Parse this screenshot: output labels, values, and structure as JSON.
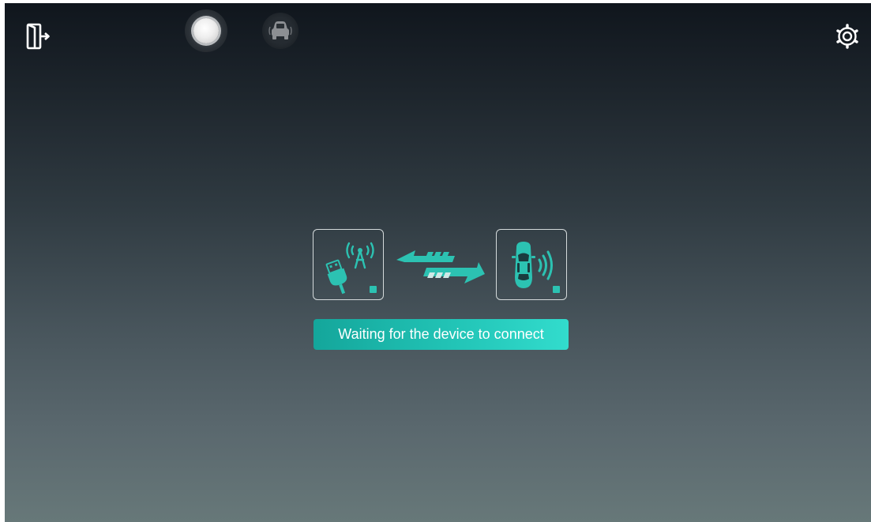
{
  "header": {
    "exit_icon": "exit-door-icon",
    "record_icon": "record-circle-icon",
    "mode_icon": "car-rear-icon",
    "settings_icon": "gear-icon"
  },
  "connection": {
    "device_icon": "usb-antenna-icon",
    "transfer_icon": "bidirectional-arrows-icon",
    "vehicle_icon": "car-signal-icon",
    "status_text": "Waiting for the device to connect"
  },
  "colors": {
    "accent": "#22c4b6",
    "icon_white": "#ffffff",
    "box_border": "#d4dadb"
  }
}
